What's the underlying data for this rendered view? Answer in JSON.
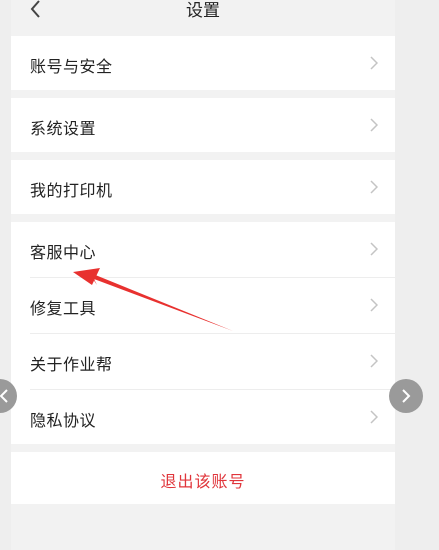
{
  "header": {
    "title": "设置",
    "back_icon": "chevron-left-icon"
  },
  "menu": {
    "items": [
      {
        "label": "账号与安全",
        "icon": "chevron-right-icon"
      },
      {
        "label": "系统设置",
        "icon": "chevron-right-icon"
      },
      {
        "label": "我的打印机",
        "icon": "chevron-right-icon"
      },
      {
        "label": "客服中心",
        "icon": "chevron-right-icon"
      },
      {
        "label": "修复工具",
        "icon": "chevron-right-icon"
      },
      {
        "label": "关于作业帮",
        "icon": "chevron-right-icon"
      },
      {
        "label": "隐私协议",
        "icon": "chevron-right-icon"
      }
    ]
  },
  "logout": {
    "label": "退出该账号"
  },
  "colors": {
    "background": "#f2f2f2",
    "card": "#ffffff",
    "logout_text": "#e0353b",
    "annotation_arrow": "#e8312f",
    "chevron": "#c4c4c4"
  },
  "overlay": {
    "prev_icon": "chevron-left-icon",
    "next_icon": "chevron-right-icon",
    "annotation": "red-arrow-icon"
  }
}
